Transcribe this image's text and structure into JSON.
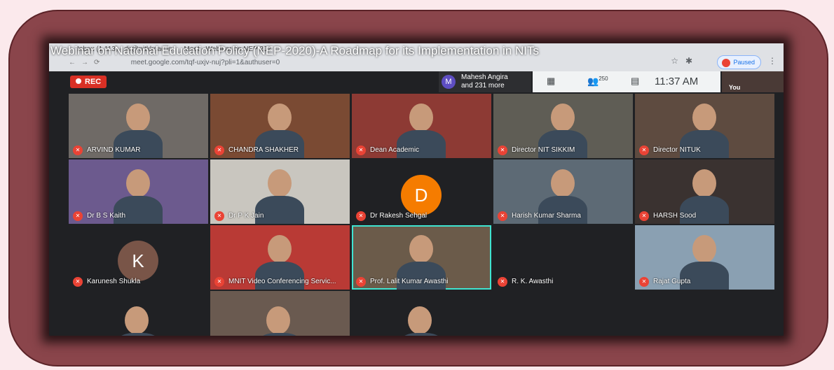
{
  "webinar_title": "Webinar on National Education Policy (NEP-2020)-A Roadmap for its Implementation in NITs",
  "browser": {
    "tabs": [
      "Inbox (1,113) - dir@nitkkr.ac.in",
      "Meet - Webinar on NEP 202"
    ],
    "url": "meet.google.com/tqf-uxjv-nuj?pli=1&authuser=0",
    "paused_label": "Paused"
  },
  "meet": {
    "rec_label": "REC",
    "joined_initial": "M",
    "joined_name": "Mahesh Angira",
    "joined_more": "and 231 more",
    "participant_count": "250",
    "time": "11:37 AM",
    "you_label": "You"
  },
  "participants": [
    {
      "name": "ARVIND KUMAR"
    },
    {
      "name": "CHANDRA SHAKHER"
    },
    {
      "name": "Dean Academic"
    },
    {
      "name": "Director NIT SIKKIM"
    },
    {
      "name": "Director NITUK"
    },
    {
      "name": "Dr B S Kaith"
    },
    {
      "name": "Dr P K Jain"
    },
    {
      "name": "Dr Rakesh Sehgal",
      "initial": "D",
      "color": "#f57c00"
    },
    {
      "name": "Harish Kumar Sharma"
    },
    {
      "name": "HARSH Sood"
    },
    {
      "name": "Karunesh Shukla",
      "initial": "K",
      "color": "#795548"
    },
    {
      "name": "MNIT Video Conferencing Servic..."
    },
    {
      "name": "Prof. Lalit Kumar Awasthi"
    },
    {
      "name": "R. K. Awasthi"
    },
    {
      "name": "Rajat Gupta"
    },
    {
      "name": ""
    },
    {
      "name": ""
    },
    {
      "name": ""
    }
  ],
  "colors": {
    "frame": "#8a454b",
    "background": "#fbe9ec",
    "mic_off": "#ea4335",
    "active_speaker": "#3fe4d1"
  }
}
